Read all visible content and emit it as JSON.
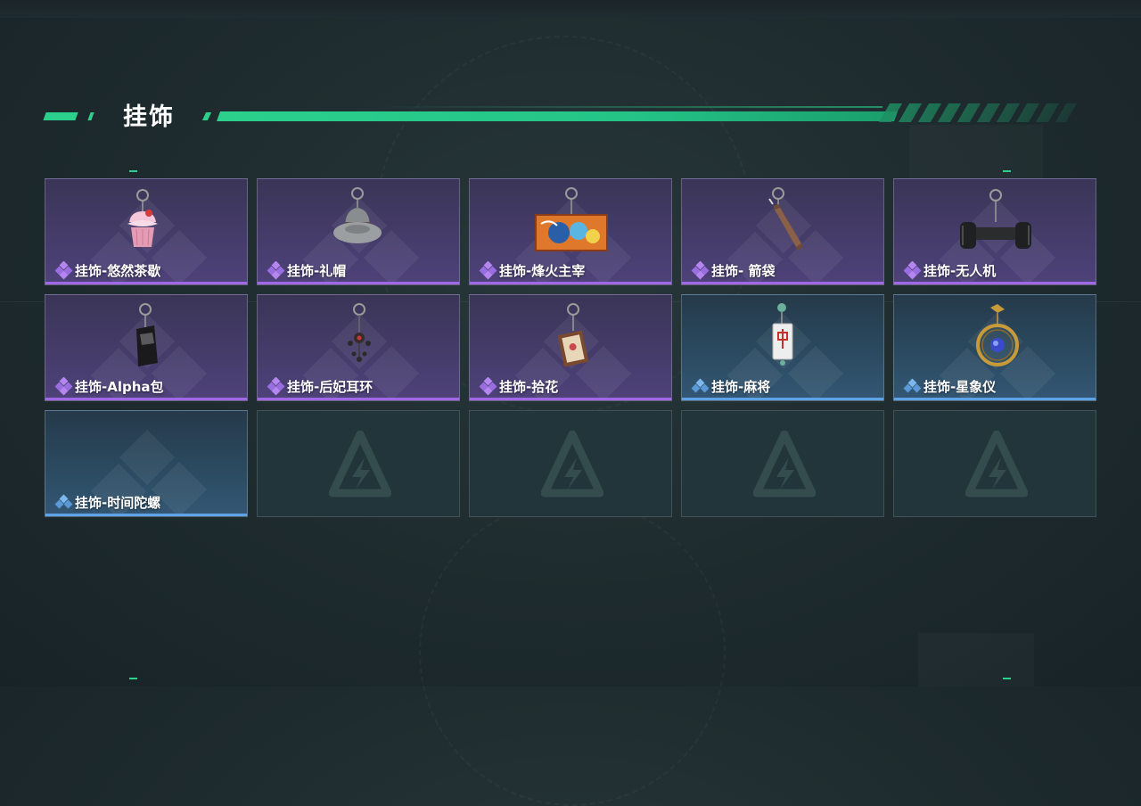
{
  "section": {
    "title": "挂饰"
  },
  "colors": {
    "accent": "#2bd08d",
    "rarity_epic": "#a068e6",
    "rarity_rare": "#5ea3e8"
  },
  "items": [
    {
      "name": "挂饰-悠然茶歇",
      "rarity": "purple",
      "icon": "cupcake-charm-icon"
    },
    {
      "name": "挂饰-礼帽",
      "rarity": "purple",
      "icon": "fedora-hat-charm-icon"
    },
    {
      "name": "挂饰-烽火主宰",
      "rarity": "purple",
      "icon": "graffiti-badge-charm-icon"
    },
    {
      "name": "挂饰- 箭袋",
      "rarity": "purple",
      "icon": "arrow-quiver-charm-icon"
    },
    {
      "name": "挂饰-无人机",
      "rarity": "purple",
      "icon": "drone-charm-icon"
    },
    {
      "name": "挂饰-Alpha包",
      "rarity": "purple",
      "icon": "alpha-pack-charm-icon"
    },
    {
      "name": "挂饰-后妃耳环",
      "rarity": "purple",
      "icon": "earring-charm-icon"
    },
    {
      "name": "挂饰-拾花",
      "rarity": "purple",
      "icon": "flower-card-charm-icon"
    },
    {
      "name": "挂饰-麻将",
      "rarity": "blue",
      "icon": "mahjong-tile-charm-icon"
    },
    {
      "name": "挂饰-星象仪",
      "rarity": "blue",
      "icon": "astrolabe-charm-icon"
    },
    {
      "name": "挂饰-时间陀螺",
      "rarity": "blue",
      "icon": ""
    }
  ],
  "empty_slots": 4,
  "empty_slot_icon": "empty-slot-logo-icon"
}
